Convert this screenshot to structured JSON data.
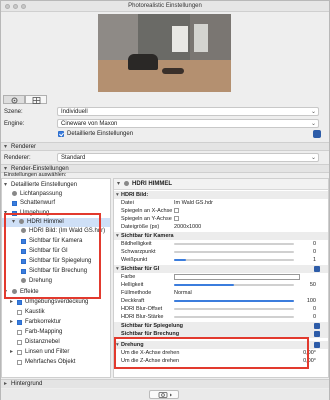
{
  "window": {
    "title": "Photorealistic Einstellungen"
  },
  "colors": {
    "accent": "#3b7ddd",
    "highlight": "#e23a2e",
    "selection": "#cfe0f7"
  },
  "tabs": [
    {
      "name": "settings-tab",
      "icon": "gear-icon"
    },
    {
      "name": "layout-tab",
      "icon": "grid-icon"
    }
  ],
  "scene": {
    "label": "Szene:",
    "value": "Individuell"
  },
  "engine": {
    "label": "Engine:",
    "value": "Cineware von Maxon"
  },
  "detailed": {
    "label": "Detaillierte Einstellungen",
    "checked": true
  },
  "renderer_section": {
    "label": "Renderer"
  },
  "renderer": {
    "label": "Renderer:",
    "value": "Standard"
  },
  "render_settings_section": {
    "label": "Render-Einstellungen"
  },
  "choose_label": "Einstellungen auswählen:",
  "tree": [
    {
      "label": "Detaillierte Einstellungen"
    },
    {
      "label": "Lichtanpassung"
    },
    {
      "label": "Schattenwurf"
    },
    {
      "label": "Umgebung"
    },
    {
      "label": "HDRI Himmel"
    },
    {
      "label": "HDRI Bild: (Im Wald GS.hdr)"
    },
    {
      "label": "Sichtbar für Kamera"
    },
    {
      "label": "Sichtbar für GI"
    },
    {
      "label": "Sichtbar für Spiegelung"
    },
    {
      "label": "Sichtbar für Brechung"
    },
    {
      "label": "Drehung"
    },
    {
      "label": "Effekte"
    },
    {
      "label": "Umgebungsverdeckung"
    },
    {
      "label": "Kaustik"
    },
    {
      "label": "Farbkorrektur"
    },
    {
      "label": "Farb-Mapping"
    },
    {
      "label": "Distanznebel"
    },
    {
      "label": "Linsen und Filter"
    },
    {
      "label": "Mehrfaches Objekt"
    }
  ],
  "right": {
    "header": "HDRI HIMMEL",
    "hdri_bild": {
      "section": "HDRI Bild:",
      "datei_label": "Datei",
      "datei_value": "Im Wald GS.hdr",
      "spiegeln_x": "Spiegeln an X-Achse",
      "spiegeln_y": "Spiegeln an Y-Achse",
      "groesse_label": "Dateigröße (px)",
      "groesse_value": "2000x1000"
    },
    "kamera": {
      "section": "Sichtbar für Kamera",
      "helligkeit": "Bildhelligkeit",
      "helligkeit_value": "0",
      "schwarz": "Schwarzpunkt",
      "schwarz_value": "0",
      "weiss": "Weißpunkt",
      "weiss_value": "1"
    },
    "gi": {
      "section": "Sichtbar für GI",
      "farbe": "Farbe",
      "helligkeit": "Helligkeit",
      "helligkeit_value": "50",
      "fuellmethode": "Füllmethode",
      "fuellmethode_value": "Normal",
      "deckkraft": "Deckkraft",
      "deckkraft_value": "100",
      "blur_offset": "HDRI Blur-Offset",
      "blur_offset_value": "0",
      "blur_staerke": "HDRI Blur-Stärke",
      "blur_staerke_value": "0"
    },
    "spiegelung": "Sichtbar für Spiegelung",
    "brechung": "Sichtbar für Brechung",
    "drehung": {
      "section": "Drehung",
      "x_label": "Um die X-Achse drehen",
      "x_value": "0,00°",
      "z_label": "Um die Z-Achse drehen",
      "z_value": "0,00°"
    }
  },
  "hintergrund": {
    "label": "Hintergrund"
  }
}
